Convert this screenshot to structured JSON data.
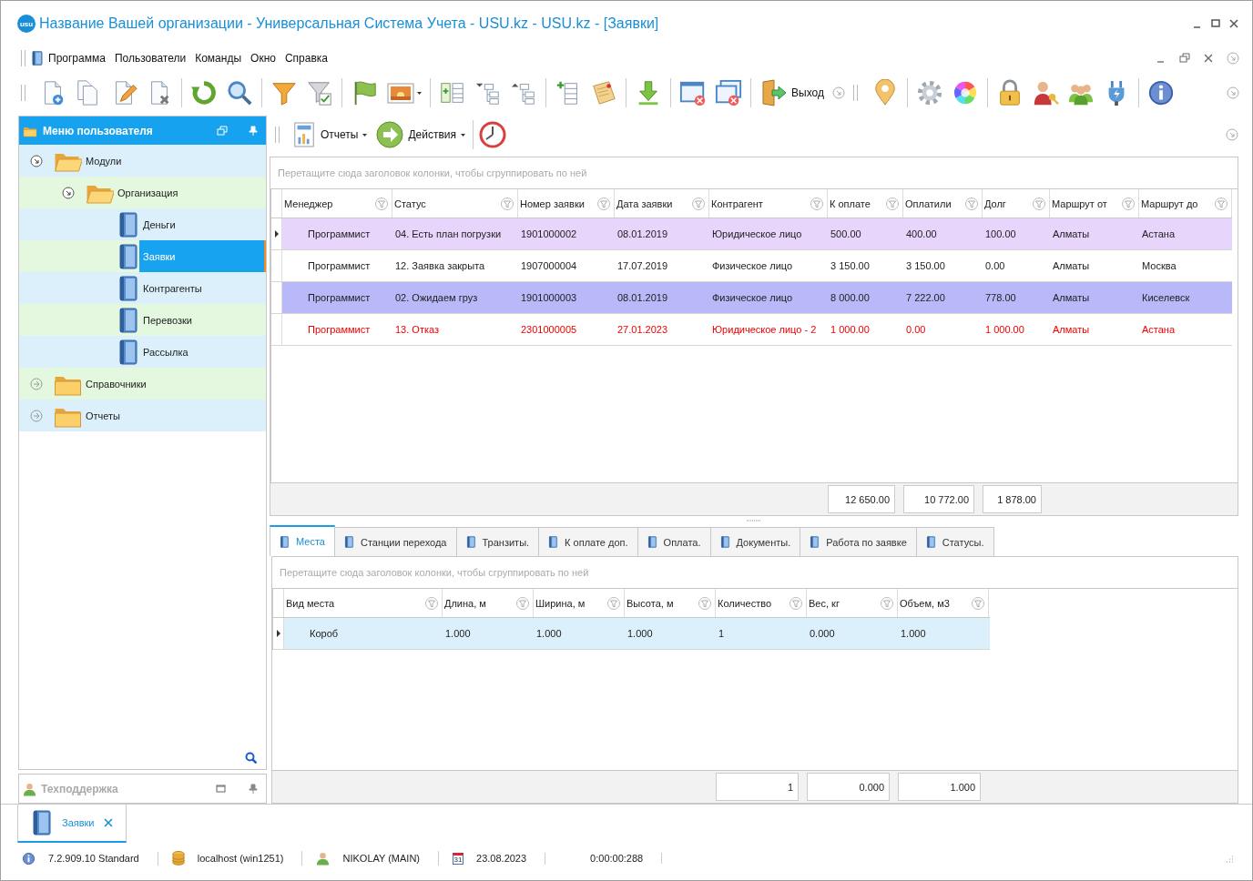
{
  "window": {
    "title": "Название Вашей организации - Универсальная Система Учета - USU.kz - USU.kz - [Заявки]",
    "logo_text": "usu"
  },
  "menu": [
    "Программа",
    "Пользователи",
    "Команды",
    "Окно",
    "Справка"
  ],
  "toolbar": {
    "exit_label": "Выход"
  },
  "sidebar": {
    "title": "Меню пользователя",
    "support_title": "Техподдержка",
    "items": [
      {
        "label": "Модули",
        "selected": false,
        "expanded": true,
        "children": [
          {
            "label": "Организация",
            "selected": false,
            "expanded": true,
            "children": [
              {
                "label": "Деньги",
                "selected": false
              },
              {
                "label": "Заявки",
                "selected": true
              },
              {
                "label": "Контрагенты",
                "selected": false
              },
              {
                "label": "Перевозки",
                "selected": false
              },
              {
                "label": "Рассылка",
                "selected": false
              }
            ]
          }
        ]
      },
      {
        "label": "Справочники",
        "selected": false,
        "expanded": false
      },
      {
        "label": "Отчеты",
        "selected": false,
        "expanded": false
      }
    ]
  },
  "grid_toolbar": {
    "buttons": [
      {
        "kind": "reports",
        "label": "Отчеты"
      },
      {
        "kind": "actions",
        "label": "Действия"
      }
    ]
  },
  "grid": {
    "group_hint": "Перетащите сюда заголовок колонки, чтобы сгруппировать по ней",
    "columns": [
      {
        "label": "Менеджер"
      },
      {
        "label": "Статус"
      },
      {
        "label": "Номер заявки"
      },
      {
        "label": "Дата заявки"
      },
      {
        "label": "Контрагент"
      },
      {
        "label": "К оплате",
        "total": "12 650.00"
      },
      {
        "label": "Оплатили",
        "total": "10 772.00"
      },
      {
        "label": "Долг",
        "total": "1 878.00"
      },
      {
        "label": "Маршрут от"
      },
      {
        "label": "Маршрут до"
      }
    ],
    "rows": [
      {
        "selected": true,
        "color": "#e8d5fb",
        "warning": false,
        "cells": [
          "Программист",
          "04. Есть план погрузки",
          "1901000002",
          "08.01.2019",
          "Юридическое лицо",
          "500.00",
          "400.00",
          "100.00",
          "Алматы",
          "Астана"
        ]
      },
      {
        "selected": false,
        "color": "#ffffff",
        "warning": false,
        "cells": [
          "Программист",
          "12. Заявка закрыта",
          "1907000004",
          "17.07.2019",
          "Физическое лицо",
          "3 150.00",
          "3 150.00",
          "0.00",
          "Алматы",
          "Москва"
        ]
      },
      {
        "selected": false,
        "color": "#b9b9f9",
        "warning": false,
        "cells": [
          "Программист",
          "02. Ожидаем груз",
          "1901000003",
          "08.01.2019",
          "Физическое лицо",
          "8 000.00",
          "7 222.00",
          "778.00",
          "Алматы",
          "Киселевск"
        ]
      },
      {
        "selected": false,
        "color": "#ffffff",
        "warning": true,
        "cells": [
          "Программист",
          "13. Отказ",
          "2301000005",
          "27.01.2023",
          "Юридическое лицо - 2",
          "1 000.00",
          "0.00",
          "1 000.00",
          "Алматы",
          "Астана"
        ]
      }
    ]
  },
  "tabs": [
    {
      "label": "Места",
      "selected": true
    },
    {
      "label": "Станции перехода",
      "selected": false
    },
    {
      "label": "Транзиты.",
      "selected": false
    },
    {
      "label": "К оплате доп.",
      "selected": false
    },
    {
      "label": "Оплата.",
      "selected": false
    },
    {
      "label": "Документы.",
      "selected": false
    },
    {
      "label": "Работа по заявке",
      "selected": false
    },
    {
      "label": "Статусы.",
      "selected": false
    }
  ],
  "subgrid": {
    "group_hint": "Перетащите сюда заголовок колонки, чтобы сгруппировать по ней",
    "columns": [
      {
        "label": "Вид места"
      },
      {
        "label": "Длина, м"
      },
      {
        "label": "Ширина, м"
      },
      {
        "label": "Высота, м"
      },
      {
        "label": "Количество",
        "total": "1"
      },
      {
        "label": "Вес, кг",
        "total": "0.000"
      },
      {
        "label": "Объем, м3",
        "total": "1.000"
      }
    ],
    "rows": [
      {
        "selected": true,
        "color": "#dcf0fb",
        "warning": false,
        "cells": [
          "Короб",
          "1.000",
          "1.000",
          "1.000",
          "1",
          "0.000",
          "1.000"
        ]
      }
    ]
  },
  "document_tabs": [
    {
      "label": "Заявки",
      "selected": true
    }
  ],
  "status_bar": [
    {
      "kind": "version",
      "text": "7.2.909.10 Standard"
    },
    {
      "kind": "server",
      "text": "localhost (win1251)"
    },
    {
      "kind": "user",
      "text": "NIKOLAY (MAIN)"
    },
    {
      "kind": "date",
      "text": "23.08.2023",
      "icon_text": "31"
    },
    {
      "kind": "timer",
      "text": "0:00:00:288"
    }
  ]
}
